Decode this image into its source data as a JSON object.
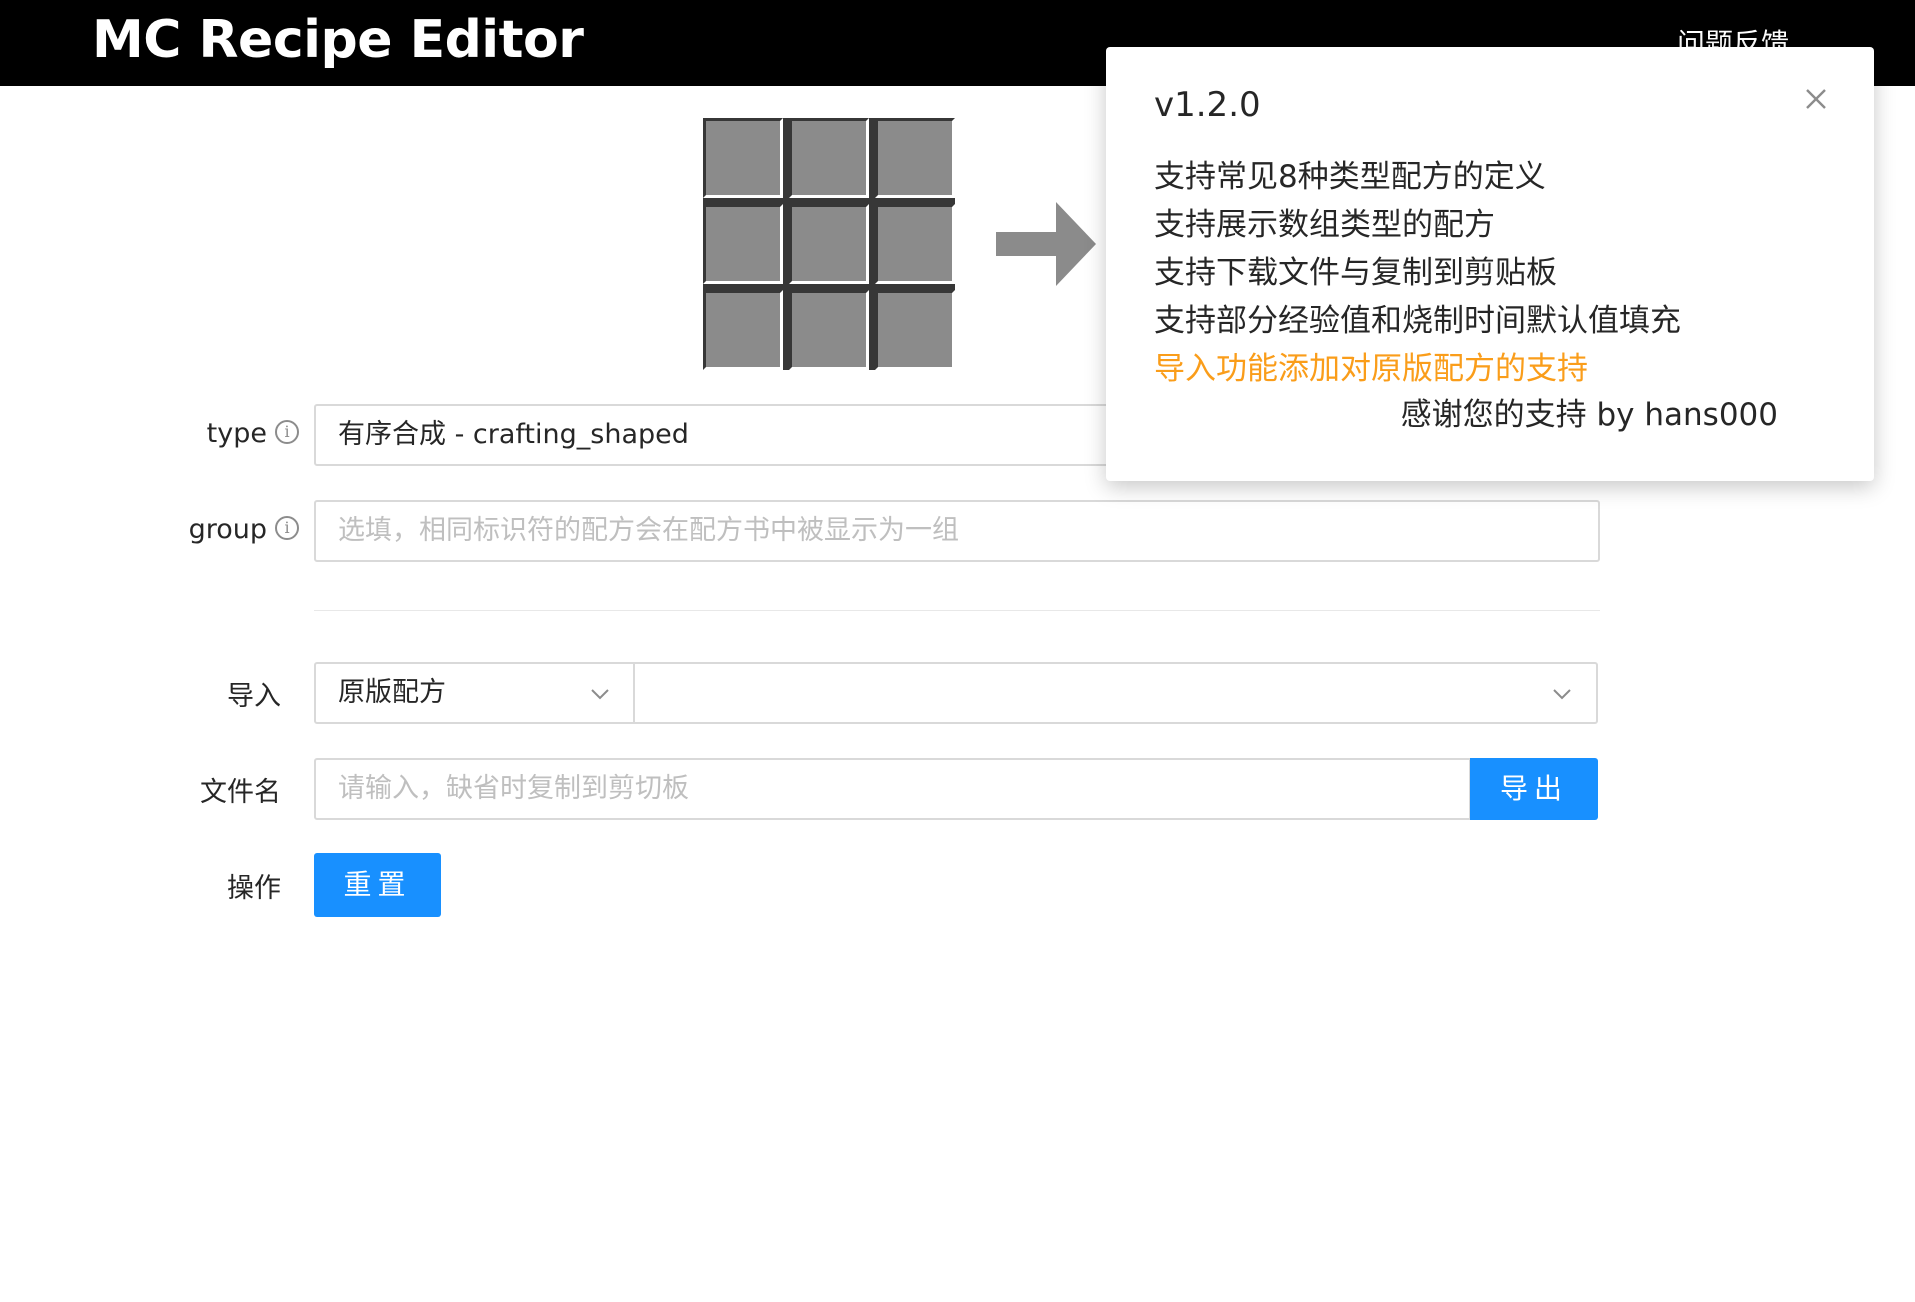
{
  "header": {
    "title": "MC Recipe Editor",
    "feedback_label": "问题反馈"
  },
  "form": {
    "type": {
      "label": "type",
      "value": "有序合成 - crafting_shaped"
    },
    "group": {
      "label": "group",
      "placeholder": "选填，相同标识符的配方会在配方书中被显示为一组"
    },
    "import": {
      "label": "导入",
      "source_value": "原版配方",
      "recipe_value": ""
    },
    "filename": {
      "label": "文件名",
      "placeholder": "请输入，缺省时复制到剪切板",
      "export_label": "导出"
    },
    "actions": {
      "label": "操作",
      "reset_label": "重置"
    }
  },
  "notice": {
    "title": "v1.2.0",
    "lines": [
      "支持常见8种类型配方的定义",
      "支持展示数组类型的配方",
      "支持下载文件与复制到剪贴板",
      "支持部分经验值和烧制时间默认值填充",
      "导入功能添加对原版配方的支持"
    ],
    "signature": "感谢您的支持 by hans000",
    "highlight_color": "#fa9d1a"
  },
  "colors": {
    "primary": "#1890ff",
    "header_bg": "#000000",
    "slot": "#8b8b8b"
  },
  "icons": {
    "info": "info-circle-icon",
    "chevron": "chevron-down-icon",
    "close": "close-icon",
    "arrow": "arrow-right-icon"
  }
}
